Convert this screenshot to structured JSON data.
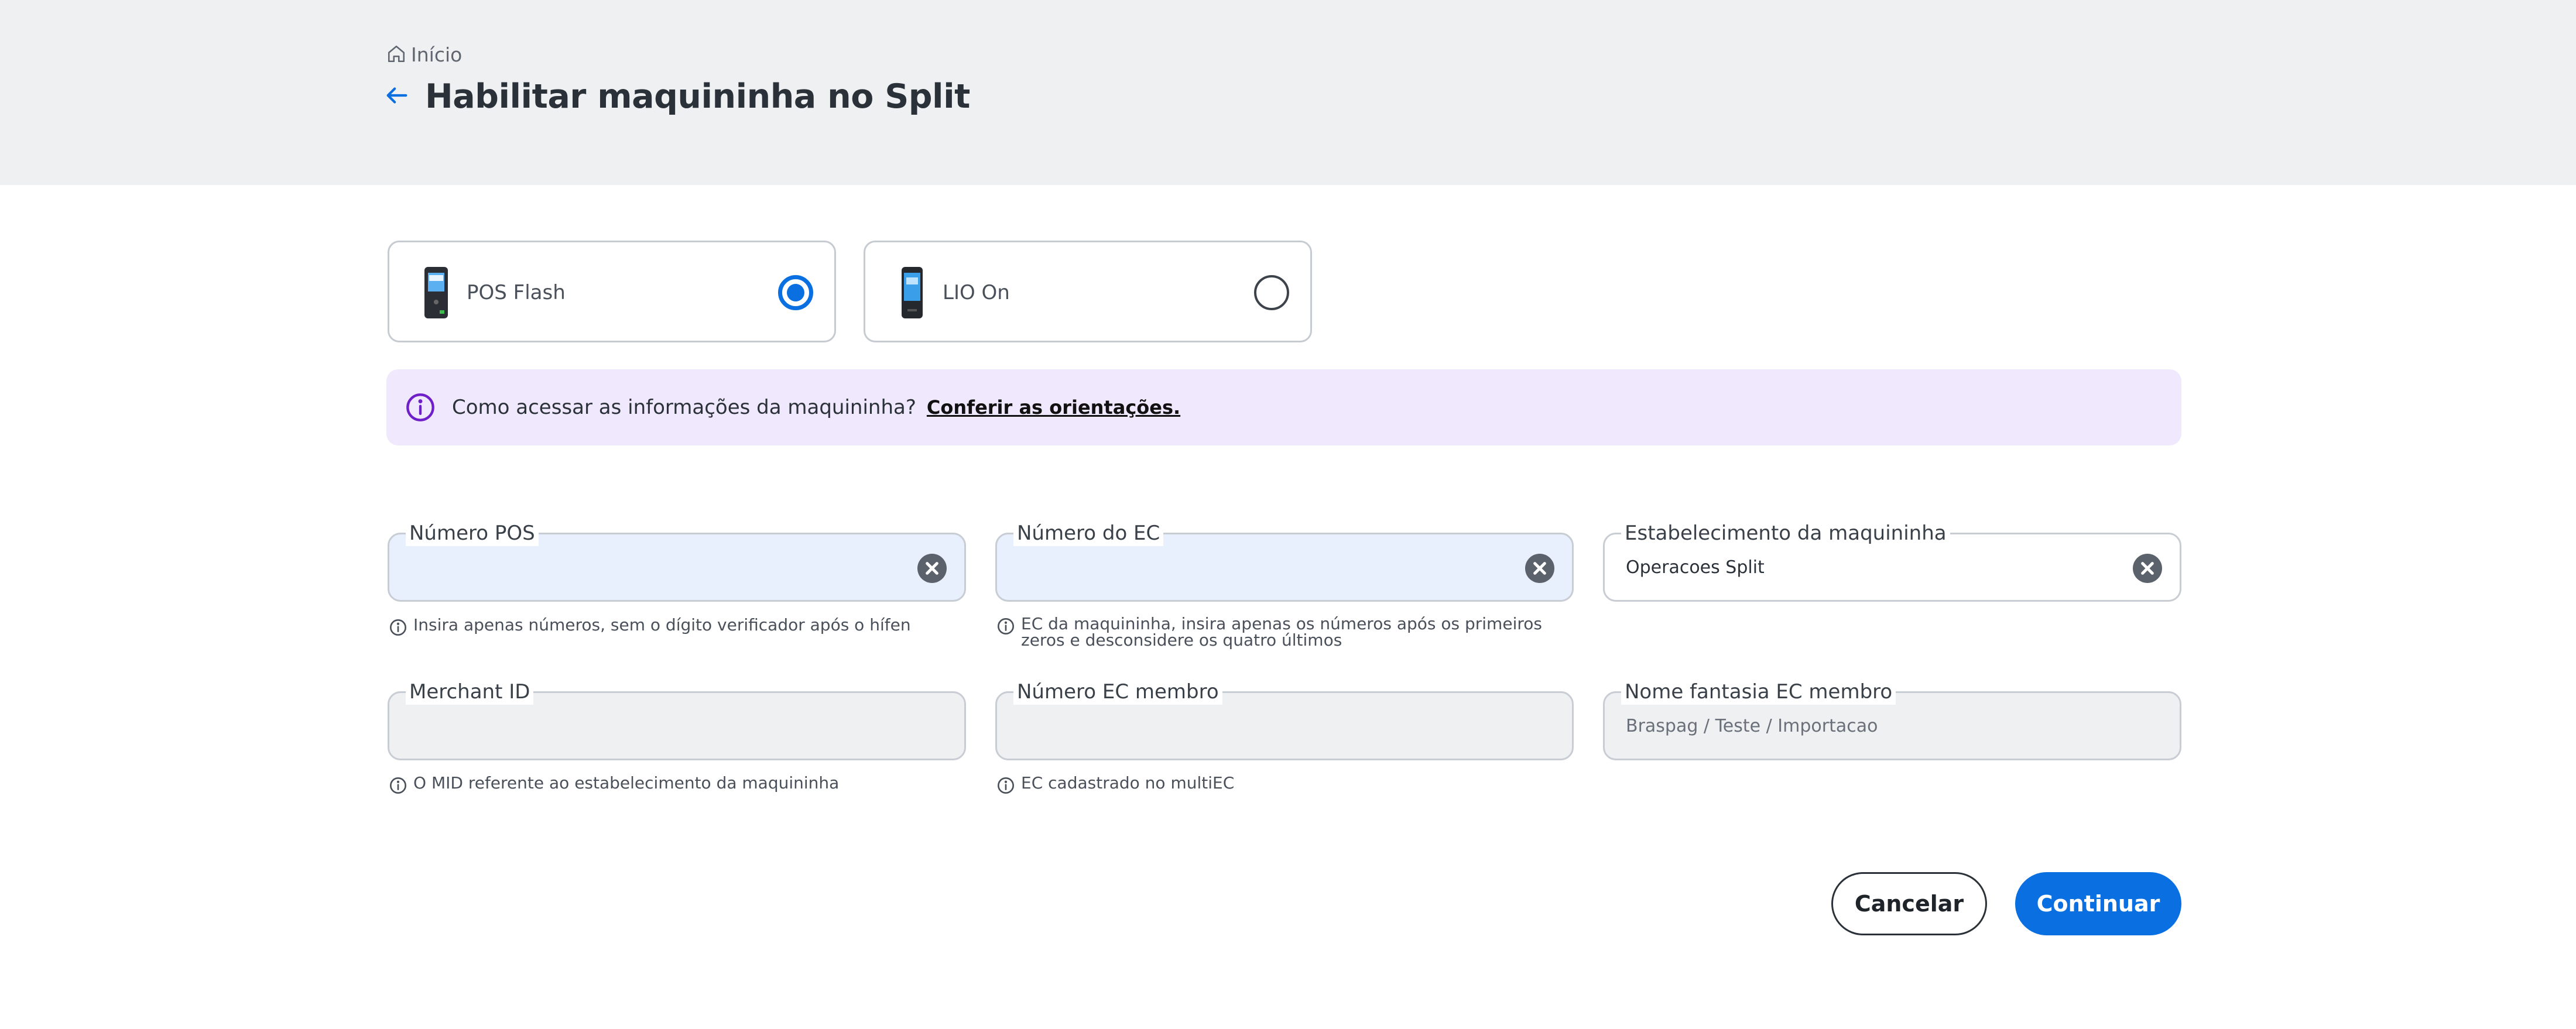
{
  "breadcrumb": {
    "label": "Início"
  },
  "header": {
    "title": "Habilitar maquininha no Split"
  },
  "devices": [
    {
      "label": "POS Flash",
      "selected": true
    },
    {
      "label": "LIO On",
      "selected": false
    }
  ],
  "info": {
    "text": "Como acessar as informações da maquininha?",
    "link": "Conferir as orientações."
  },
  "fields": {
    "numero_pos": {
      "label": "Número POS",
      "value": "",
      "hint": "Insira apenas números, sem o dígito verificador após o hífen"
    },
    "numero_ec": {
      "label": "Número do EC",
      "value": "",
      "hint_line1": "EC da maquininha, insira apenas os números após os primeiros",
      "hint_line2": "zeros e desconsidere os quatro últimos"
    },
    "estabelecimento": {
      "label": "Estabelecimento da maquininha",
      "value": "Operacoes Split"
    },
    "merchant_id": {
      "label": "Merchant ID",
      "value": "",
      "hint": "O MID referente ao estabelecimento da maquininha"
    },
    "numero_ec_membro": {
      "label": "Número EC membro",
      "value": "",
      "hint": "EC cadastrado no multiEC"
    },
    "nome_fantasia": {
      "label": "Nome fantasia EC membro",
      "value": "Braspag / Teste / Importacao"
    }
  },
  "actions": {
    "cancel": "Cancelar",
    "continue": "Continuar"
  },
  "colors": {
    "primary": "#0a6fe0",
    "info_bg": "#f0e8fd",
    "info_icon": "#6f1fc9",
    "header_bg": "#eff0f2",
    "blue_field": "#e8f0fd"
  }
}
